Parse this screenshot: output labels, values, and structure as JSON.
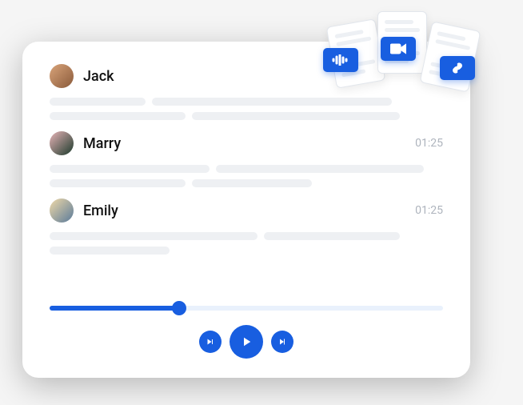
{
  "speakers": [
    {
      "name": "Jack",
      "time": ""
    },
    {
      "name": "Marry",
      "time": "01:25"
    },
    {
      "name": "Emily",
      "time": "01:25"
    }
  ],
  "player": {
    "progress_pct": 33
  },
  "files": {
    "badge1": "audio",
    "badge2": "video",
    "badge3": "link"
  }
}
